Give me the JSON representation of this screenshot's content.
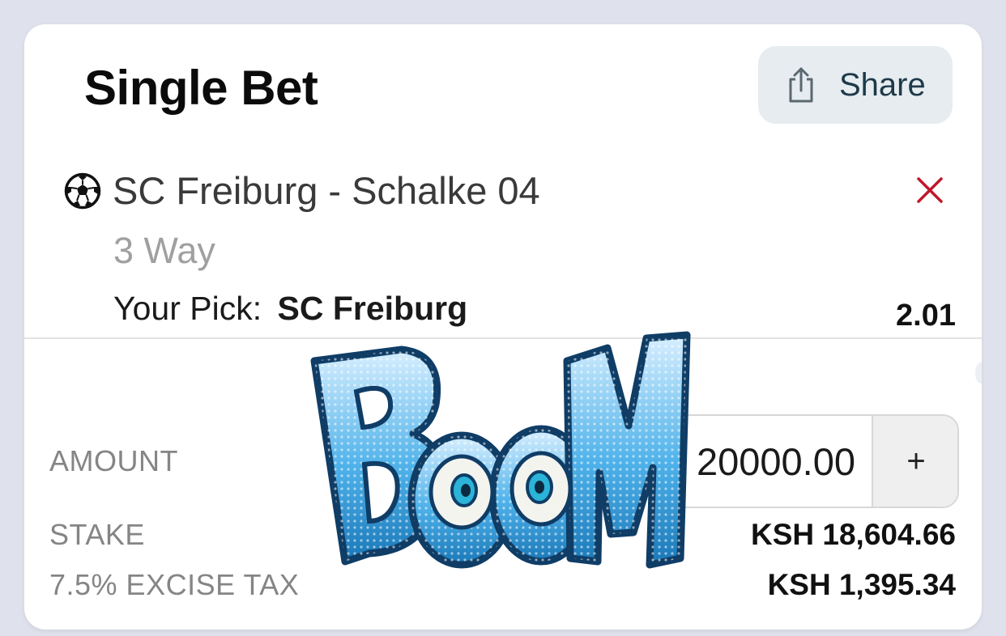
{
  "header": {
    "title": "Single Bet",
    "share_label": "Share"
  },
  "bet": {
    "sport_icon": "soccer-ball-icon",
    "match": "SC Freiburg - Schalke 04",
    "market": "3 Way",
    "pick_label": "Your Pick:",
    "pick_value": "SC Freiburg",
    "odds": "2.01"
  },
  "summary": {
    "amount_label": "AMOUNT",
    "amount_value": "20000.00",
    "plus_label": "+",
    "stake_label": "STAKE",
    "stake_value": "KSH 18,604.66",
    "tax_label": "7.5% EXCISE TAX",
    "tax_value": "KSH 1,395.34"
  },
  "overlay": {
    "sticker_text": "BOOM"
  },
  "colors": {
    "background": "#dfe2ec",
    "card": "#ffffff",
    "share_bg": "#e6ecef",
    "share_text": "#1d3a4a",
    "remove_x": "#c0172b",
    "boom_blue": "#2f9ad6"
  }
}
